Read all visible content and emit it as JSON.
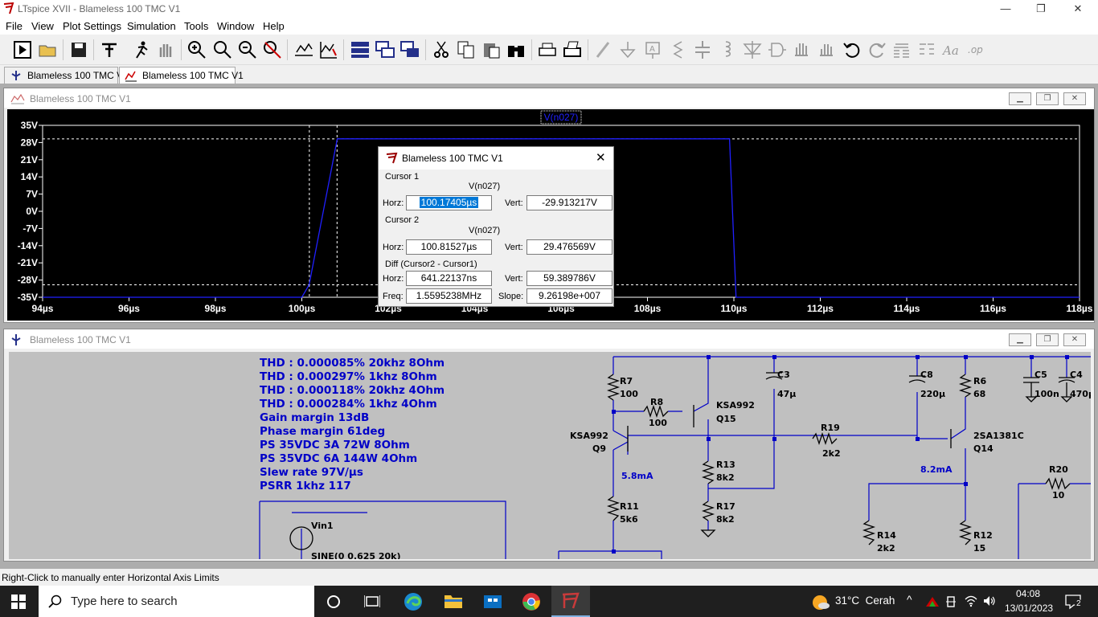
{
  "window": {
    "title": "LTspice XVII - Blameless 100 TMC V1",
    "minimize": "—",
    "restore": "❐",
    "close": "✕"
  },
  "menu": [
    "File",
    "View",
    "Plot Settings",
    "Simulation",
    "Tools",
    "Window",
    "Help"
  ],
  "tabs": [
    {
      "label": "Blameless 100 TMC V1",
      "type": "schematic"
    },
    {
      "label": "Blameless 100 TMC V1",
      "type": "waveform",
      "active": true
    }
  ],
  "plot_window": {
    "title": "Blameless 100 TMC V1",
    "trace_label": "V(n027)"
  },
  "chart_data": {
    "type": "line",
    "title": "",
    "series": [
      {
        "name": "V(n027)",
        "color": "#2020ff",
        "x": [
          94.0,
          100.0,
          100.17,
          100.82,
          109.9,
          110.05,
          110.35,
          118.0
        ],
        "y": [
          -35.0,
          -35.0,
          -29.9,
          29.5,
          29.5,
          -35.0,
          -35.0,
          -35.0
        ]
      }
    ],
    "x_ticks": [
      "94µs",
      "96µs",
      "98µs",
      "100µs",
      "102µs",
      "104µs",
      "106µs",
      "108µs",
      "110µs",
      "112µs",
      "114µs",
      "116µs",
      "118µs"
    ],
    "y_ticks": [
      "35V",
      "28V",
      "21V",
      "14V",
      "7V",
      "0V",
      "-7V",
      "-14V",
      "-21V",
      "-28V",
      "-35V"
    ],
    "xlim": [
      94,
      118
    ],
    "ylim": [
      -35,
      35
    ],
    "xunit": "µs",
    "cursors": {
      "x1": 100.17405,
      "x2": 100.81527,
      "y1": -29.913217,
      "y2": 29.476569
    }
  },
  "cursor_dialog": {
    "title": "Blameless 100 TMC V1",
    "cursor1": {
      "label": "Cursor 1",
      "trace": "V(n027)",
      "horz": "100.17405µs",
      "vert": "-29.913217V"
    },
    "cursor2": {
      "label": "Cursor 2",
      "trace": "V(n027)",
      "horz": "100.81527µs",
      "vert": "29.476569V"
    },
    "diff": {
      "label": "Diff (Cursor2 - Cursor1)",
      "horz": "641.22137ns",
      "vert": "59.389786V",
      "freq": "1.5595238MHz",
      "slope": "9.26198e+007"
    },
    "labels": {
      "horz": "Horz:",
      "vert": "Vert:",
      "freq": "Freq:",
      "slope": "Slope:"
    }
  },
  "schematic_window": {
    "title": "Blameless 100 TMC V1"
  },
  "notes": [
    "THD : 0.000085% 20khz 8Ohm",
    "THD : 0.000297% 1khz 8Ohm",
    "THD : 0.000118% 20khz 4Ohm",
    "THD : 0.000284% 1khz 4Ohm",
    "Gain margin 13dB",
    "Phase margin 61deg",
    "PS 35VDC 3A 72W 8Ohm",
    "PS 35VDC 6A 144W 4Ohm",
    "Slew rate 97V/µs",
    "PSRR 1khz 117"
  ],
  "components": {
    "r7": "R7",
    "r7v": "100",
    "r8": "R8",
    "r8v": "100",
    "q15t": "KSA992",
    "q15": "Q15",
    "q9t": "KSA992",
    "q9": "Q9",
    "i1": "5.8mA",
    "r13": "R13",
    "r13v": "8k2",
    "r17": "R17",
    "r17v": "8k2",
    "r11": "R11",
    "r11v": "5k6",
    "c3": "C3",
    "c3v": "47µ",
    "r19": "R19",
    "r19v": "2k2",
    "c8": "C8",
    "c8v": "220µ",
    "r6": "R6",
    "r6v": "68",
    "q14t": "2SA1381C",
    "q14": "Q14",
    "i2": "8.2mA",
    "c5": "C5",
    "c5v": "100n",
    "c4": "C4",
    "c4v": "470µ",
    "r20": "R20",
    "r20v": "10",
    "r14": "R14",
    "r14v": "2k2",
    "r12": "R12",
    "r12v": "15",
    "vin": "Vin1",
    "vinv": "SINE(0 0.625 20k)"
  },
  "status": "Right-Click to manually enter Horizontal Axis Limits",
  "taskbar": {
    "search": "Type here to search",
    "weather": "31°C  Cerah",
    "time": "04:08",
    "date": "13/01/2023",
    "notif": "2"
  }
}
